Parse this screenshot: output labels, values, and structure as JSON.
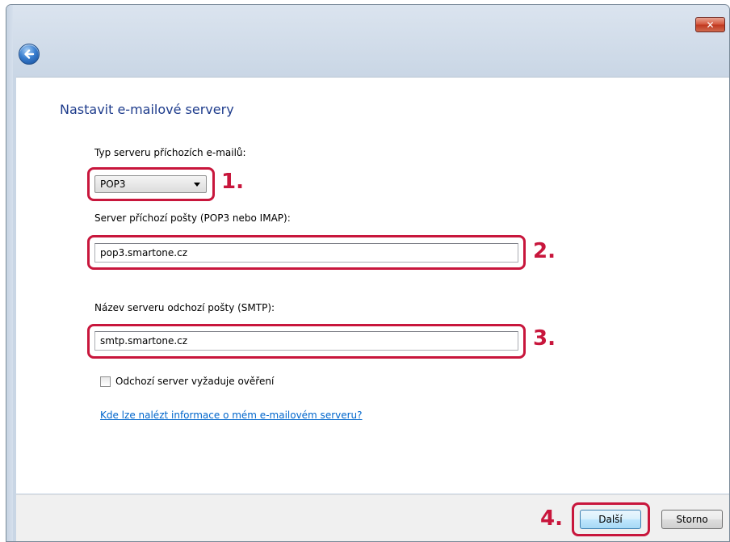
{
  "window": {
    "close_symbol": "✕",
    "back_icon": "back-arrow-icon"
  },
  "page_title": "Nastavit e-mailové servery",
  "incoming_type": {
    "label": "Typ serveru příchozích e-mailů:",
    "selected": "POP3",
    "step": "1."
  },
  "incoming_server": {
    "label": "Server příchozí pošty (POP3 nebo IMAP):",
    "value": "pop3.smartone.cz",
    "step": "2."
  },
  "outgoing_server": {
    "label": "Název serveru odchozí pošty (SMTP):",
    "value": "smtp.smartone.cz",
    "step": "3."
  },
  "auth_checkbox": {
    "label": "Odchozí server vyžaduje ověření",
    "checked": false
  },
  "help_link": "Kde lze nalézt informace o mém e-mailovém serveru?",
  "footer": {
    "step": "4.",
    "next_label": "Další",
    "cancel_label": "Storno"
  },
  "colors": {
    "highlight": "#c8163c",
    "title": "#1e3c8c",
    "link": "#0066cc"
  }
}
